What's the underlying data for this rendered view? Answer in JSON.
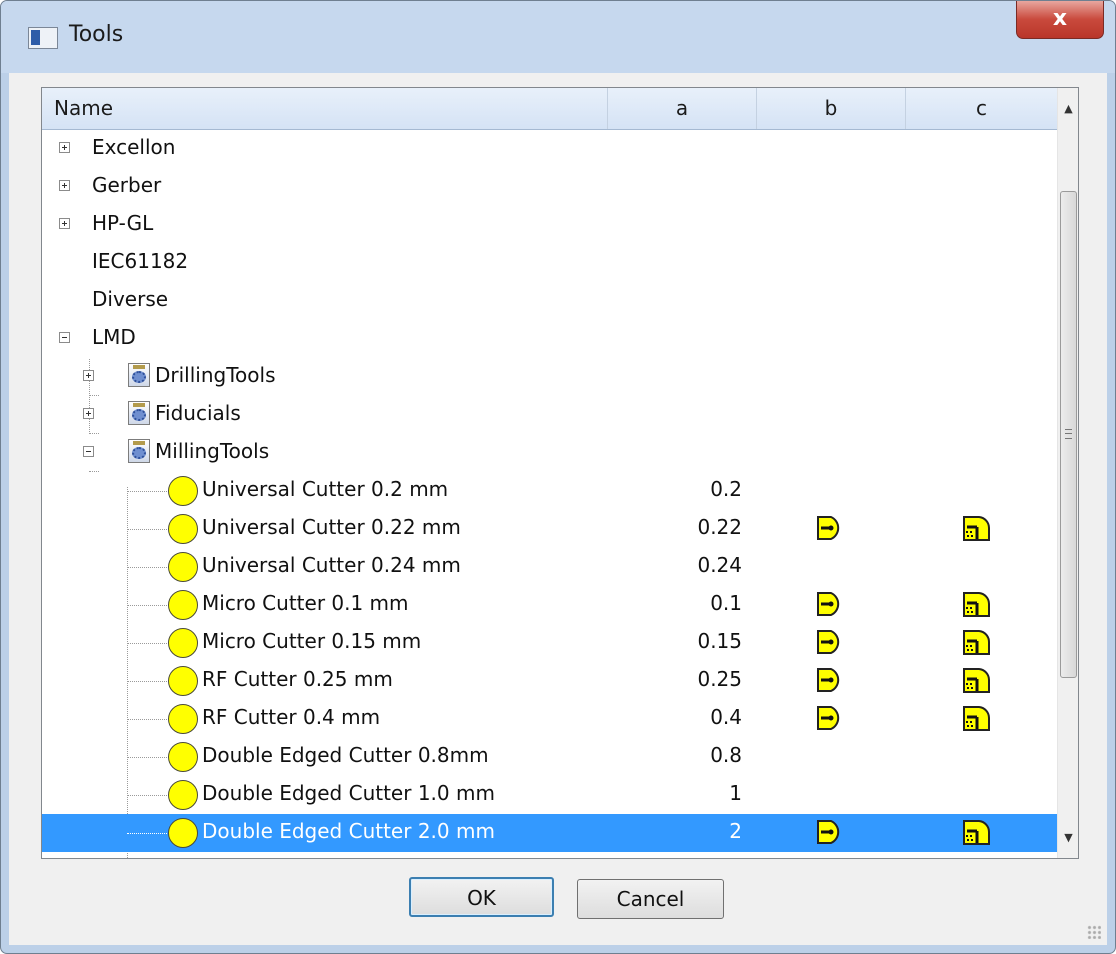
{
  "window": {
    "title": "Tools",
    "close_label": "x"
  },
  "tree": {
    "columns": [
      "Name",
      "a",
      "b",
      "c"
    ],
    "rows": [
      {
        "label": "Excellon"
      },
      {
        "label": "Gerber"
      },
      {
        "label": "HP-GL"
      },
      {
        "label": "IEC61182"
      },
      {
        "label": "Diverse"
      },
      {
        "label": "LMD"
      },
      {
        "label": "DrillingTools"
      },
      {
        "label": "Fiducials"
      },
      {
        "label": "MillingTools"
      },
      {
        "label": "Universal Cutter 0.2 mm",
        "a": "0.2",
        "b": false,
        "c": false
      },
      {
        "label": "Universal Cutter 0.22 mm",
        "a": "0.22",
        "b": true,
        "c": true
      },
      {
        "label": "Universal Cutter 0.24 mm",
        "a": "0.24",
        "b": false,
        "c": false
      },
      {
        "label": "Micro Cutter 0.1 mm",
        "a": "0.1",
        "b": true,
        "c": true
      },
      {
        "label": "Micro Cutter 0.15 mm",
        "a": "0.15",
        "b": true,
        "c": true
      },
      {
        "label": "RF Cutter 0.25 mm",
        "a": "0.25",
        "b": true,
        "c": true
      },
      {
        "label": "RF Cutter 0.4 mm",
        "a": "0.4",
        "b": true,
        "c": true
      },
      {
        "label": "Double Edged Cutter 0.8mm",
        "a": "0.8",
        "b": false,
        "c": false
      },
      {
        "label": "Double Edged Cutter 1.0 mm",
        "a": "1",
        "b": false,
        "c": false
      },
      {
        "label": "Double Edged Cutter 2.0 mm",
        "a": "2",
        "b": true,
        "c": true,
        "selected": true
      }
    ]
  },
  "buttons": {
    "ok": "OK",
    "cancel": "Cancel"
  },
  "colors": {
    "selection": "#3399ff",
    "tool_icon": "#ffff00",
    "title_bar": "#c6d8ee"
  },
  "icons": {
    "app": "window-icon",
    "group": "gear-folder-icon",
    "tool": "yellow-circle-icon",
    "b_icon": "cutter-side-icon",
    "c_icon": "cutter-corner-icon"
  }
}
